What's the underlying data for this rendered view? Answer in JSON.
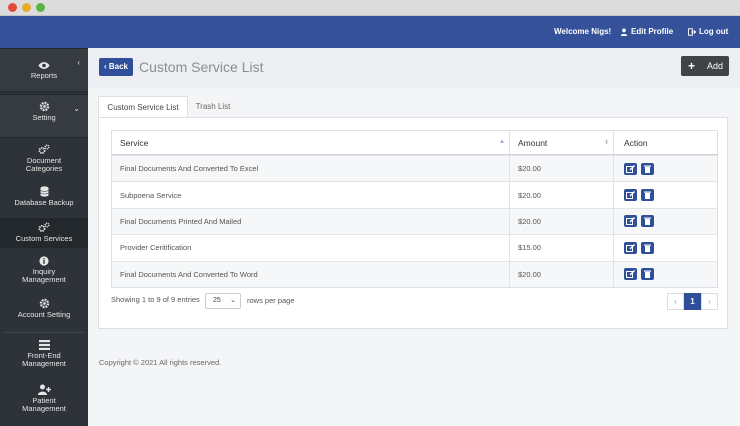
{
  "header": {
    "welcome": "Welcome Nigs!",
    "edit_profile": "Edit Profile",
    "logout": "Log out"
  },
  "sidebar": {
    "items": [
      {
        "label": "Reports",
        "icon": "eye-icon"
      },
      {
        "label": "Setting",
        "icon": "gear-icon"
      },
      {
        "label": "Document Categories",
        "icon": "gears-icon"
      },
      {
        "label": "Database Backup",
        "icon": "database-icon"
      },
      {
        "label": "Custom Services",
        "icon": "gears-icon"
      },
      {
        "label": "Inquiry Management",
        "icon": "info-icon"
      },
      {
        "label": "Account Setting",
        "icon": "gear-icon"
      },
      {
        "label": "Front-End Management",
        "icon": "list-icon"
      },
      {
        "label": "Patient Management",
        "icon": "user-plus-icon"
      }
    ]
  },
  "page": {
    "back_label": "Back",
    "title": "Custom Service List",
    "add_label": "Add"
  },
  "tabs": [
    "Custom Service List",
    "Trash List"
  ],
  "table": {
    "headers": [
      "Service",
      "Amount",
      "Action"
    ],
    "rows": [
      {
        "service": "Final Documents And Converted To Excel",
        "amount": "$20.00"
      },
      {
        "service": "Subpoena Service",
        "amount": "$20.00"
      },
      {
        "service": "Final Documents Printed And Mailed",
        "amount": "$20.00"
      },
      {
        "service": "Provider Ceritification",
        "amount": "$15.00"
      },
      {
        "service": "Final Documents And Converted To Word",
        "amount": "$20.00"
      }
    ]
  },
  "footer": {
    "showing": "Showing 1 to 9 of 9 entries",
    "rows_per_page_value": "25",
    "rows_per_page_label": "rows per page",
    "page_prev": "‹",
    "current_page": "1",
    "page_next": "›"
  },
  "copyright": "Copyright © 2021 All rights reserved.",
  "colors": {
    "header": "#34519a",
    "sidebar": "#2d3338",
    "primary_button": "#2f4f9a",
    "add_button": "#404447"
  }
}
